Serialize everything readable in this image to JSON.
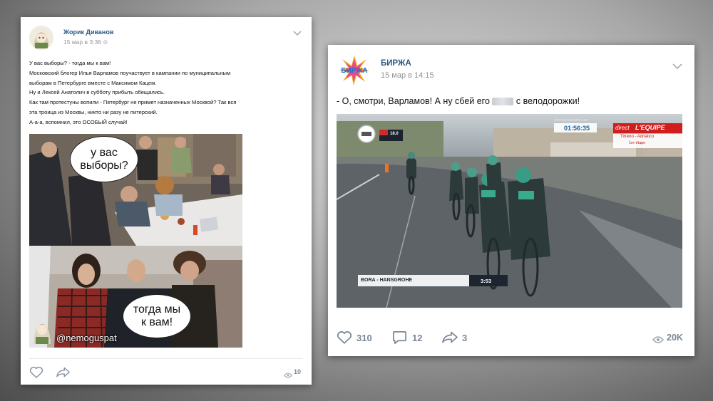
{
  "post1": {
    "author": "Жорик Диванов",
    "date": "15 мар в 3:36",
    "text_lines": [
      "У вас выборы? - тогда мы к вам!",
      "Московский блогер Илья Варламов поучаствует в кампании по муниципальным",
      "выборам в Петербурге вместе с Максимом Кацем.",
      "Ну и Лексей Анатолич в субботу прибыть обещались.",
      "Как там протестуны вопили - Петербург не примет назначенных Москвой? Так вся",
      "эта троица из Москвы, никто ни разу не питерский.",
      "А-а-а, вспомнил, это ОСОБЫЙ случай!"
    ],
    "bubble_top": "у вас\nвыборы?",
    "bubble_bottom": "тогда мы\nк вам!",
    "watermark": "@nemoguspat",
    "views": "10"
  },
  "post2": {
    "author": "БИРЖА",
    "date": "15 мар в 14:15",
    "text_before": "- О, смотри, Варламов! А ну сбей его",
    "text_after": "с велодорожки!",
    "logo_text": "БИРЖА",
    "video": {
      "clock": "01:56:35",
      "brand": "L'EQUIPE",
      "direct": "direct",
      "race": "Tirreno - Adriatico",
      "stage": "1re étape",
      "team": "BORA - HANSGROHE",
      "time": "3:53",
      "distance": "18.0",
      "channel_tag": "STATION INTERVALLE"
    },
    "likes": "310",
    "comments": "12",
    "shares": "3",
    "views": "20K"
  },
  "colors": {
    "link": "#2a5885",
    "meta": "#939393",
    "icon": "#7b8796"
  },
  "icons": [
    "chevron-down-icon",
    "heart-icon",
    "share-icon",
    "comment-icon",
    "eye-icon"
  ]
}
